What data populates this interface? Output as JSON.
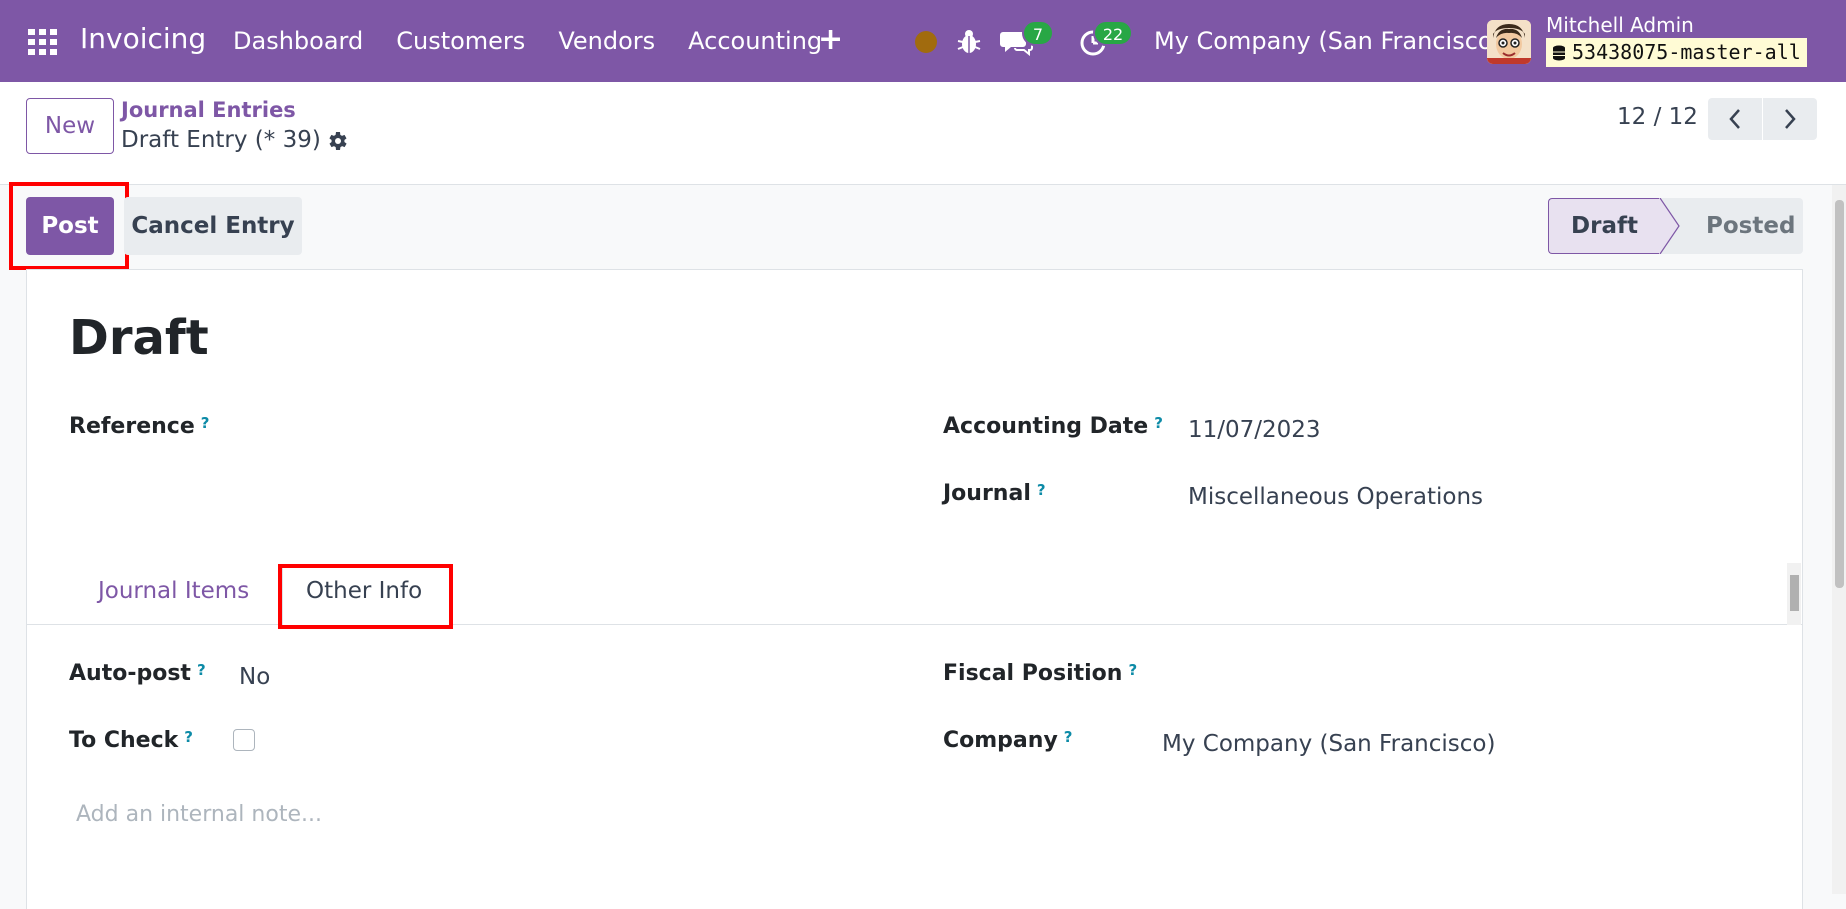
{
  "navbar": {
    "app_name": "Invoicing",
    "menu": [
      "Dashboard",
      "Customers",
      "Vendors",
      "Accounting"
    ],
    "plus": "+",
    "messages_count": "7",
    "activities_count": "22",
    "company": "My Company (San Francisco)",
    "user_name": "Mitchell Admin",
    "database": "53438075-master-all"
  },
  "control_panel": {
    "new_label": "New",
    "breadcrumb": "Journal Entries",
    "record_title": "Draft Entry (* 39)",
    "pager": "12 / 12"
  },
  "actions": {
    "post_label": "Post",
    "cancel_label": "Cancel Entry"
  },
  "statusbar": {
    "stages": [
      "Draft",
      "Posted"
    ],
    "current": "Draft"
  },
  "form": {
    "title": "Draft",
    "reference_label": "Reference",
    "accounting_date_label": "Accounting Date",
    "accounting_date": "11/07/2023",
    "journal_label": "Journal",
    "journal": "Miscellaneous Operations",
    "help_mark": "?"
  },
  "tabs": {
    "journal_items": "Journal Items",
    "other_info": "Other Info",
    "active": "Other Info"
  },
  "other_info": {
    "auto_post_label": "Auto-post",
    "auto_post": "No",
    "to_check_label": "To Check",
    "to_check": false,
    "fiscal_position_label": "Fiscal Position",
    "company_label": "Company",
    "company": "My Company (San Francisco)",
    "note_placeholder": "Add an internal note..."
  },
  "colors": {
    "brand": "#7e57a6",
    "highlight": "#ff0000",
    "badge": "#28a745"
  }
}
